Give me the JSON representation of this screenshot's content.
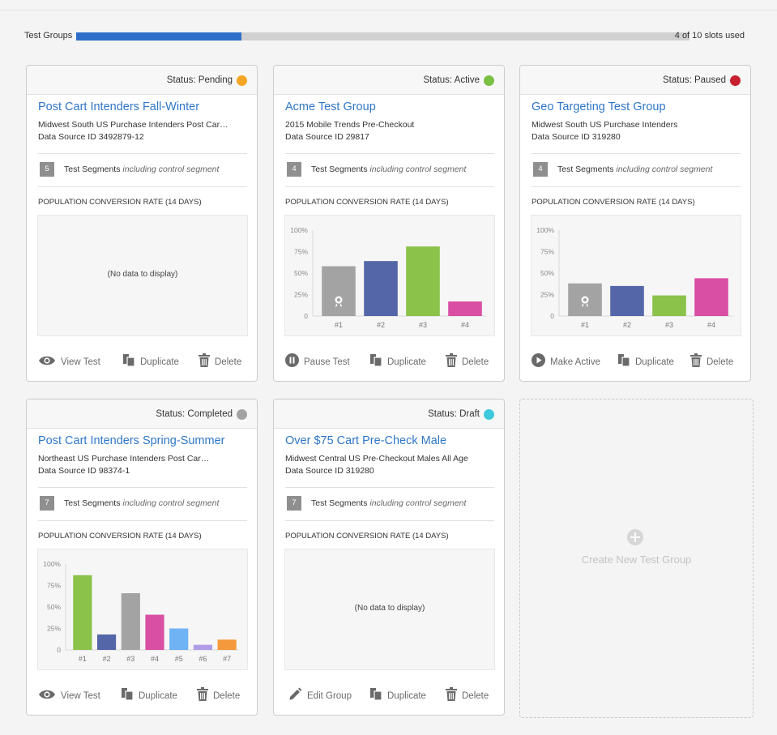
{
  "header": {
    "label": "Test Groups",
    "slots_text": "4 of 10 slots used",
    "progress_fraction": 0.27
  },
  "colors": {
    "accent": "#2f77c8",
    "progress": "#2f6fc9",
    "pending": "#f5a623",
    "active": "#7bc043",
    "paused": "#c8202f",
    "completed": "#a3a3a3",
    "draft": "#3ec9dc"
  },
  "cards": [
    {
      "status": "Status: Pending",
      "status_color": "#f5a623",
      "title": "Post Cart Intenders Fall-Winter",
      "subtitle": "Midwest South US Purchase Intenders Post Car…",
      "source": "Data Source ID 3492879-12",
      "segments_count": "5",
      "segments_label": "Test Segments",
      "segments_note": "including control segment",
      "population_label": "POPULATION CONVERSION RATE (14 DAYS)",
      "no_data": "(No data to display)",
      "actions": [
        {
          "icon": "eye-icon",
          "label": "View Test"
        },
        {
          "icon": "duplicate-icon",
          "label": "Duplicate"
        },
        {
          "icon": "trash-icon",
          "label": "Delete"
        }
      ]
    },
    {
      "status": "Status: Active",
      "status_color": "#7bc043",
      "title": "Acme Test Group",
      "subtitle": "2015 Mobile Trends Pre-Checkout",
      "source": "Data Source ID 29817",
      "segments_count": "4",
      "segments_label": "Test Segments",
      "segments_note": "including control segment",
      "population_label": "POPULATION CONVERSION RATE (14 DAYS)",
      "actions": [
        {
          "icon": "pause-icon",
          "label": "Pause Test"
        },
        {
          "icon": "duplicate-icon",
          "label": "Duplicate"
        },
        {
          "icon": "trash-icon",
          "label": "Delete"
        }
      ]
    },
    {
      "status": "Status: Paused",
      "status_color": "#c8202f",
      "title": "Geo Targeting Test Group",
      "subtitle": "Midwest South US Purchase Intenders",
      "source": "Data Source ID 319280",
      "segments_count": "4",
      "segments_label": "Test Segments",
      "segments_note": "including control segment",
      "population_label": "POPULATION CONVERSION RATE (14 DAYS)",
      "actions": [
        {
          "icon": "play-icon",
          "label": "Make Active"
        },
        {
          "icon": "duplicate-icon",
          "label": "Duplicate"
        },
        {
          "icon": "trash-icon",
          "label": "Delete"
        }
      ]
    },
    {
      "status": "Status: Completed",
      "status_color": "#a3a3a3",
      "title": "Post Cart Intenders Spring-Summer",
      "subtitle": "Northeast US Purchase Intenders Post Car…",
      "source": "Data Source ID 98374-1",
      "segments_count": "7",
      "segments_label": "Test Segments",
      "segments_note": "including control segment",
      "population_label": "POPULATION CONVERSION RATE (14 DAYS)",
      "actions": [
        {
          "icon": "eye-icon",
          "label": "View Test"
        },
        {
          "icon": "duplicate-icon",
          "label": "Duplicate"
        },
        {
          "icon": "trash-icon",
          "label": "Delete"
        }
      ]
    },
    {
      "status": "Status: Draft",
      "status_color": "#3ec9dc",
      "title": "Over $75 Cart Pre-Check Male",
      "subtitle": "Midwest Central US Pre-Checkout Males All Age",
      "source": "Data Source ID 319280",
      "segments_count": "7",
      "segments_label": "Test Segments",
      "segments_note": "including control segment",
      "population_label": "POPULATION CONVERSION RATE (14 DAYS)",
      "no_data": "(No data to display)",
      "actions": [
        {
          "icon": "pencil-icon",
          "label": "Edit Group"
        },
        {
          "icon": "duplicate-icon",
          "label": "Duplicate"
        },
        {
          "icon": "trash-icon",
          "label": "Delete"
        }
      ]
    }
  ],
  "create": {
    "label": "Create New Test Group"
  },
  "chart_data": [
    {
      "type": "bar",
      "card": 1,
      "categories": [
        "#1",
        "#2",
        "#3",
        "#4"
      ],
      "values": [
        58,
        64,
        81,
        17
      ],
      "colors": [
        "#a3a3a3",
        "#5566a8",
        "#8ac24a",
        "#d94fa3"
      ],
      "control_index": 0,
      "yticks": [
        "100%",
        "75%",
        "50%",
        "25%",
        "0"
      ],
      "ylim": [
        0,
        100
      ]
    },
    {
      "type": "bar",
      "card": 2,
      "categories": [
        "#1",
        "#2",
        "#3",
        "#4"
      ],
      "values": [
        38,
        35,
        24,
        44
      ],
      "colors": [
        "#a3a3a3",
        "#5566a8",
        "#8ac24a",
        "#d94fa3"
      ],
      "control_index": 0,
      "yticks": [
        "100%",
        "75%",
        "50%",
        "25%",
        "0"
      ],
      "ylim": [
        0,
        100
      ]
    },
    {
      "type": "bar",
      "card": 3,
      "categories": [
        "#1",
        "#2",
        "#3",
        "#4",
        "#5",
        "#6",
        "#7"
      ],
      "values": [
        87,
        18,
        66,
        41,
        25,
        6,
        12
      ],
      "colors": [
        "#8ac24a",
        "#5566a8",
        "#a3a3a3",
        "#d94fa3",
        "#6fb3f5",
        "#b09ce8",
        "#f59a3c"
      ],
      "yticks": [
        "100%",
        "75%",
        "50%",
        "25%",
        "0"
      ],
      "ylim": [
        0,
        100
      ]
    }
  ]
}
